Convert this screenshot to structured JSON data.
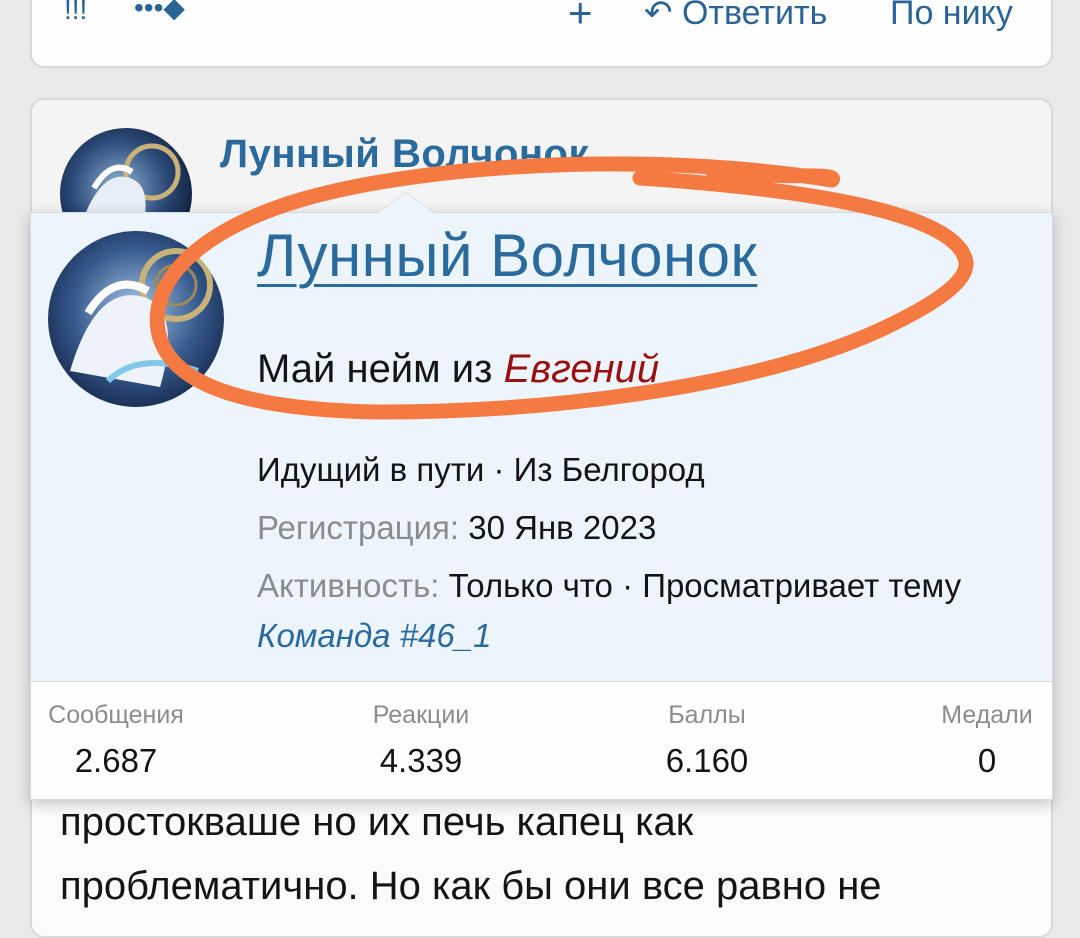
{
  "toolbar": {
    "icon_left": "!!!",
    "icon_second": "•••◆",
    "add_label": "+",
    "reply_label": "Ответить",
    "by_nick_label": "По нику"
  },
  "post": {
    "username": "Лунный Волчонок",
    "body_lines": [
      "простокваше но их печь капец как",
      "проблематично. Но как бы они все равно не"
    ]
  },
  "popup": {
    "username": "Лунный Волчонок",
    "title_prefix": "Май нейм из ",
    "title_highlight": "Евгений",
    "rank_location": "Идущий в пути · Из Белгород",
    "registration_label": "Регистрация:",
    "registration_value": "30 Янв 2023",
    "activity_label": "Активность:",
    "activity_value": "Только что · Просматривает тему",
    "team_link": "Команда #46_1",
    "stats": [
      {
        "label": "Сообщения",
        "value": "2.687"
      },
      {
        "label": "Реакции",
        "value": "4.339"
      },
      {
        "label": "Баллы",
        "value": "6.160"
      },
      {
        "label": "Медали",
        "value": "0"
      }
    ]
  },
  "colors": {
    "link": "#2a6a9c",
    "highlight": "#9b0f0f",
    "annotation": "#f47a42",
    "popup_bg": "#edf5fc"
  }
}
